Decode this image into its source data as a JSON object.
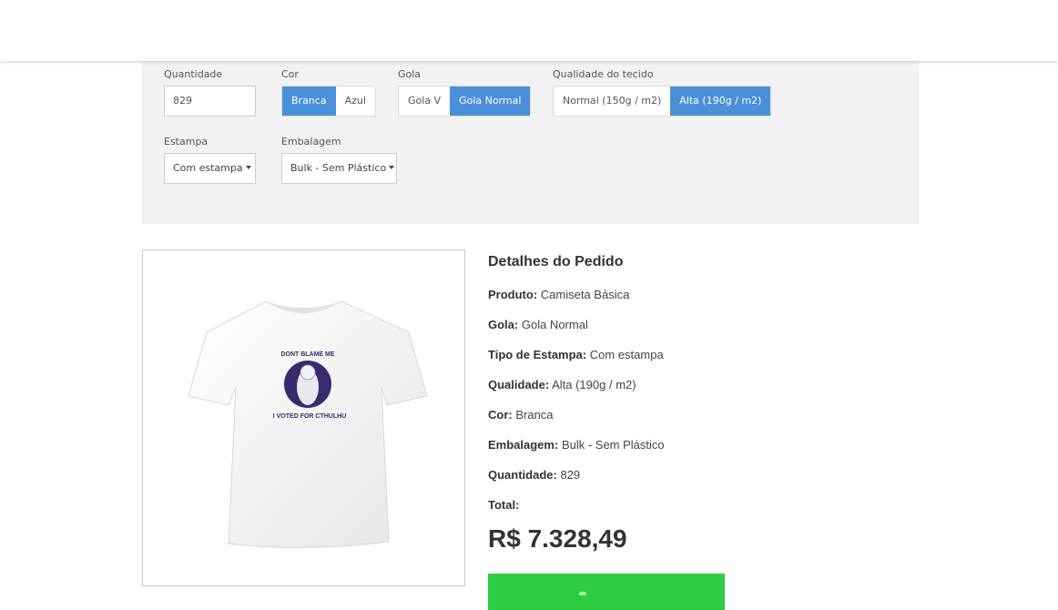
{
  "config": {
    "quantity": {
      "label": "Quantidade",
      "value": "829"
    },
    "color": {
      "label": "Cor",
      "options": [
        "Branca",
        "Azul"
      ],
      "selected": "Branca"
    },
    "collar": {
      "label": "Gola",
      "options": [
        "Gola V",
        "Gola Normal"
      ],
      "selected": "Gola Normal"
    },
    "quality": {
      "label": "Qualidade do tecido",
      "options": [
        "Normal (150g / m2)",
        "Alta (190g / m2)"
      ],
      "selected": "Alta (190g / m2)"
    },
    "print": {
      "label": "Estampa",
      "value": "Com estampa"
    },
    "packaging": {
      "label": "Embalagem",
      "value": "Bulk - Sem Plástico"
    }
  },
  "product_image": {
    "print_top_text": "DONT BLAME ME",
    "print_bottom_text": "I VOTED FOR CTHULHU",
    "colors": {
      "shirt": "#f4f4f4",
      "shirt_shadow": "#dcdcdc",
      "print_circle": "#3b2a6e",
      "print_text": "#3b2a6e"
    }
  },
  "details": {
    "title": "Detalhes do Pedido",
    "rows": [
      {
        "label": "Produto:",
        "value": "Camiseta Básica"
      },
      {
        "label": "Gola:",
        "value": "Gola Normal"
      },
      {
        "label": "Tipo de Estampa:",
        "value": "Com estampa"
      },
      {
        "label": "Qualidade:",
        "value": "Alta (190g / m2)"
      },
      {
        "label": "Cor:",
        "value": "Branca"
      },
      {
        "label": "Embalagem:",
        "value": "Bulk - Sem Plástico"
      },
      {
        "label": "Quantidade:",
        "value": "829"
      },
      {
        "label": "Total:",
        "value": ""
      }
    ],
    "total": "R$ 7.328,49"
  },
  "theme": {
    "accent": "#4a90d9",
    "buy_button": "#2ecc40",
    "panel_bg": "#f2f2f2"
  }
}
